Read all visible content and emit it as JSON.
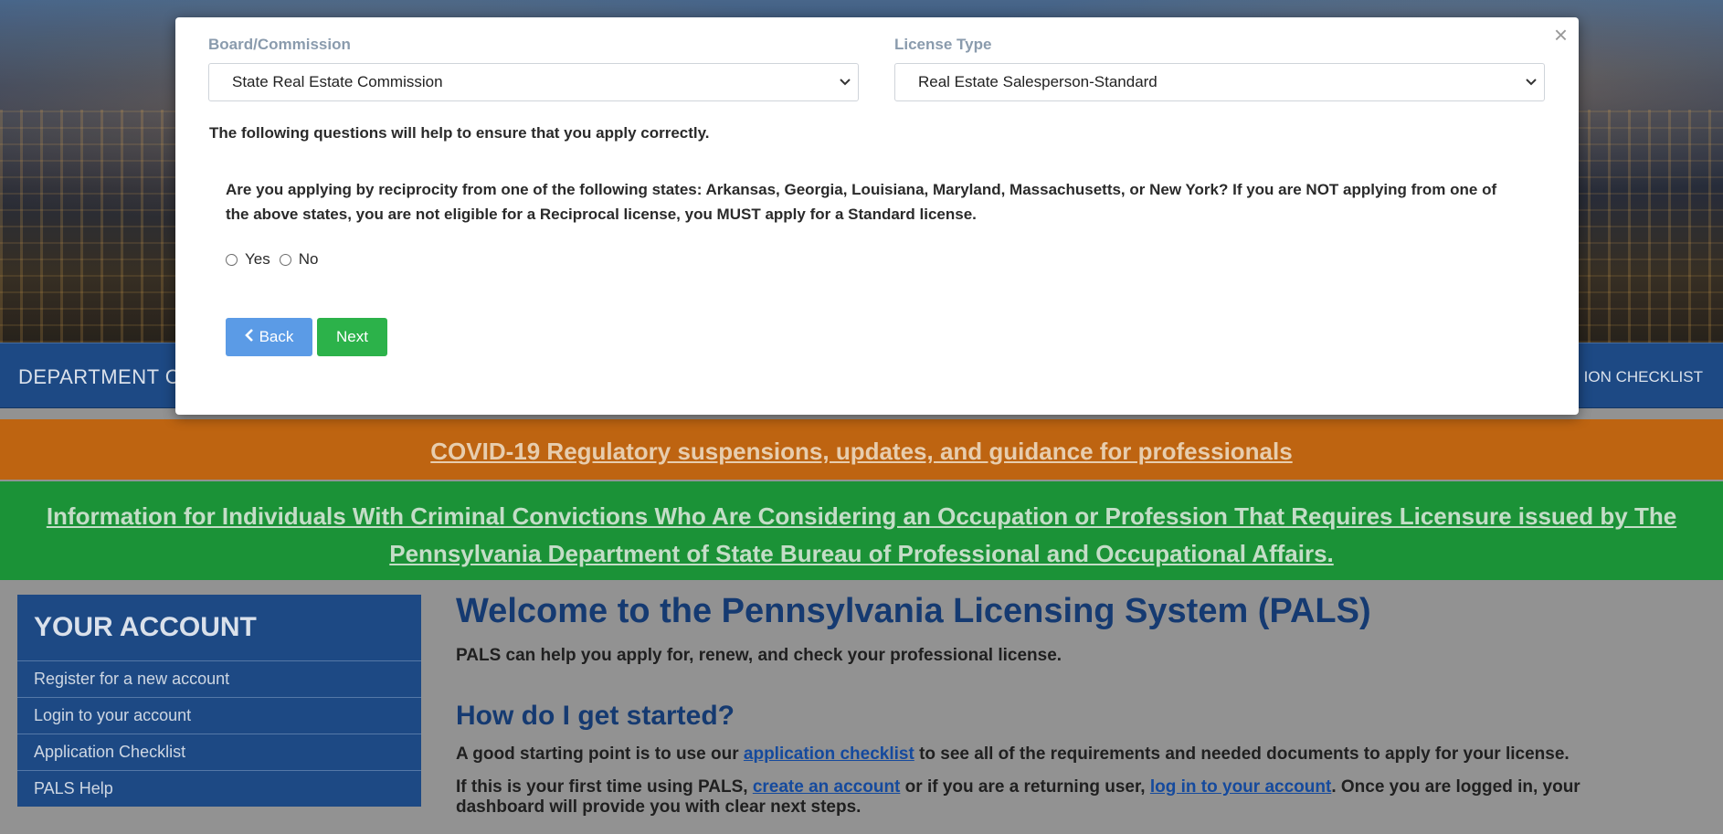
{
  "navbar": {
    "department": "DEPARTMENT C",
    "checklist": "ION CHECKLIST"
  },
  "banners": {
    "covid": "COVID-19 Regulatory suspensions, updates, and guidance for professionals",
    "criminal": "Information for Individuals With Criminal Convictions Who Are Considering an Occupation or Profession That Requires Licensure issued by The Pennsylvania Department of State Bureau of Professional and Occupational Affairs."
  },
  "sidebar": {
    "title": "YOUR ACCOUNT",
    "items": [
      {
        "label": "Register for a new account"
      },
      {
        "label": "Login to your account"
      },
      {
        "label": "Application Checklist"
      },
      {
        "label": "PALS Help"
      }
    ]
  },
  "main": {
    "title": "Welcome to the Pennsylvania Licensing System (PALS)",
    "lead": "PALS can help you apply for, renew, and check your professional license.",
    "subtitle": "How do I get started?",
    "p1_before": "A good starting point is to use our ",
    "p1_link": "application checklist",
    "p1_after": " to see all of the requirements and needed documents to apply for your license.",
    "p2_before": "If this is your first time using PALS, ",
    "p2_link1": "create an account",
    "p2_middle": " or if you are a returning user, ",
    "p2_link2": "log in to your account",
    "p2_after": ". Once you are logged in, your dashboard will provide you with clear next steps."
  },
  "modal": {
    "close": "×",
    "board_label": "Board/Commission",
    "board_value": "State Real Estate Commission",
    "license_label": "License Type",
    "license_value": "Real Estate Salesperson-Standard",
    "intro": "The following questions will help to ensure that you apply correctly.",
    "question": "Are you applying by reciprocity from one of the following states: Arkansas, Georgia, Louisiana, Maryland, Massachusetts, or New York? If you are NOT applying from one of the above states, you are not eligible for a Reciprocal license, you MUST apply for a Standard license.",
    "yes_label": "Yes",
    "no_label": "No",
    "back_label": "Back",
    "next_label": "Next"
  },
  "icons": {
    "chevron": "chevron-down-icon",
    "back_arrow": "chevron-left-icon",
    "close": "close-icon"
  },
  "colors": {
    "navbar": "#1f4d8c",
    "covid_bar": "#c96a12",
    "criminal_bar": "#1d9a3a",
    "back_button": "#5b9be6",
    "next_button": "#2cb24a",
    "heading": "#173e78"
  }
}
